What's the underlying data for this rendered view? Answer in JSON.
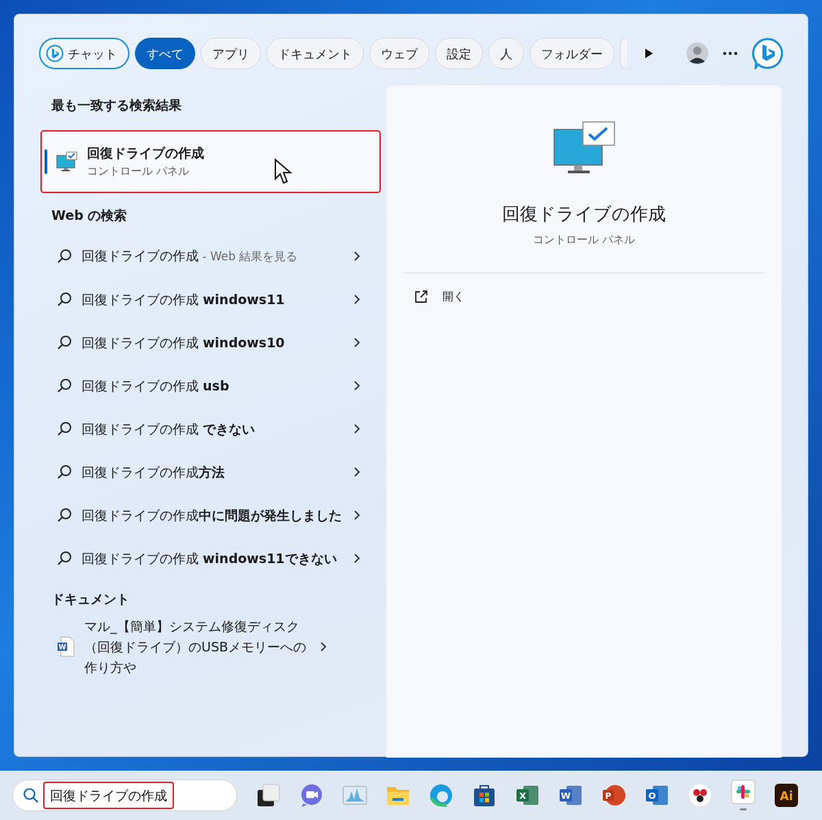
{
  "filters": [
    {
      "label": "チャット",
      "kind": "chat",
      "selected": false
    },
    {
      "label": "すべて",
      "kind": "pill",
      "selected": true
    },
    {
      "label": "アプリ",
      "kind": "pill",
      "selected": false
    },
    {
      "label": "ドキュメント",
      "kind": "pill",
      "selected": false
    },
    {
      "label": "ウェブ",
      "kind": "pill",
      "selected": false
    },
    {
      "label": "設定",
      "kind": "pill",
      "selected": false
    },
    {
      "label": "人",
      "kind": "pill",
      "selected": false
    },
    {
      "label": "フォルダー",
      "kind": "pill",
      "selected": false
    }
  ],
  "best_match": {
    "heading": "最も一致する検索結果",
    "title": "回復ドライブの作成",
    "subtitle": "コントロール パネル",
    "highlighted": true
  },
  "web": {
    "heading": "Web の検索",
    "items": [
      {
        "text": "回復ドライブの作成",
        "hint": "- Web 結果を見る"
      },
      {
        "text": "回復ドライブの作成 **windows11**"
      },
      {
        "text": "回復ドライブの作成 **windows10**"
      },
      {
        "text": "回復ドライブの作成 **usb**"
      },
      {
        "text": "回復ドライブの作成 **できない**"
      },
      {
        "text": "回復ドライブの作成**方法**"
      },
      {
        "text": "回復ドライブの作成**中に問題が発生しました**"
      },
      {
        "text": "回復ドライブの作成 **windows11できない**"
      }
    ]
  },
  "documents": {
    "heading": "ドキュメント",
    "items": [
      {
        "text": "マル_【簡単】システム修復ディスク（回復ドライブ）のUSBメモリーへの作り方や",
        "glyph": "W"
      }
    ]
  },
  "preview": {
    "title": "回復ドライブの作成",
    "subtitle": "コントロール パネル",
    "actions": [
      {
        "label": "開く"
      }
    ]
  },
  "taskbar": {
    "search": {
      "value": "回復ドライブの作成",
      "highlighted": true
    },
    "apps": [
      {
        "kind": "multitask"
      },
      {
        "kind": "meet"
      },
      {
        "kind": "monitor"
      },
      {
        "kind": "folder"
      },
      {
        "kind": "edge"
      },
      {
        "kind": "store"
      },
      {
        "kind": "letter",
        "glyph": "X",
        "color": "#1d7044"
      },
      {
        "kind": "letter",
        "glyph": "W",
        "color": "#2b5eb8"
      },
      {
        "kind": "round",
        "glyph": "P",
        "color": "#d24726"
      },
      {
        "kind": "letter",
        "glyph": "O",
        "color": "#0a64c0"
      },
      {
        "kind": "dots"
      },
      {
        "kind": "slack",
        "active": true
      },
      {
        "kind": "ai",
        "glyph": "Ai",
        "color": "#2b1500"
      }
    ]
  }
}
